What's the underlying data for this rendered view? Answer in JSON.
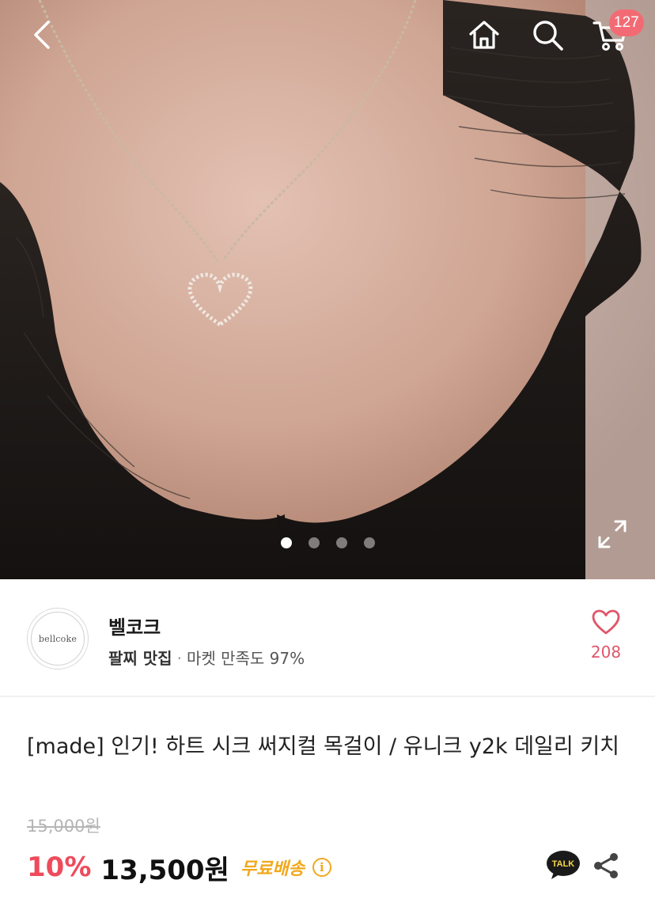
{
  "topbar": {
    "back_icon": "back-chevron-icon",
    "home_icon": "home-icon",
    "search_icon": "search-icon",
    "cart_icon": "cart-icon",
    "cart_count": "127"
  },
  "gallery": {
    "image_count": 4,
    "active_index": 0,
    "expand_icon": "expand-icon"
  },
  "seller": {
    "logo_text": "bellcoke",
    "name": "벨코크",
    "badge": "팔찌 맛집",
    "separator": "·",
    "satisfaction": "마켓 만족도 97%",
    "like_count": "208"
  },
  "product": {
    "title": "[made] 인기! 하트 시크 써지컬 목걸이 / 유니크 y2k 데일리 키치",
    "original_price": "15,000원",
    "discount": "10%",
    "price": "13,500원",
    "shipping": "무료배송",
    "info_glyph": "i",
    "talk_label": "TALK"
  },
  "colors": {
    "accent_red": "#ee4b5c",
    "badge_red": "#f26b74",
    "shipping_orange": "#f1a81c",
    "heart_pink": "#e0566a"
  }
}
